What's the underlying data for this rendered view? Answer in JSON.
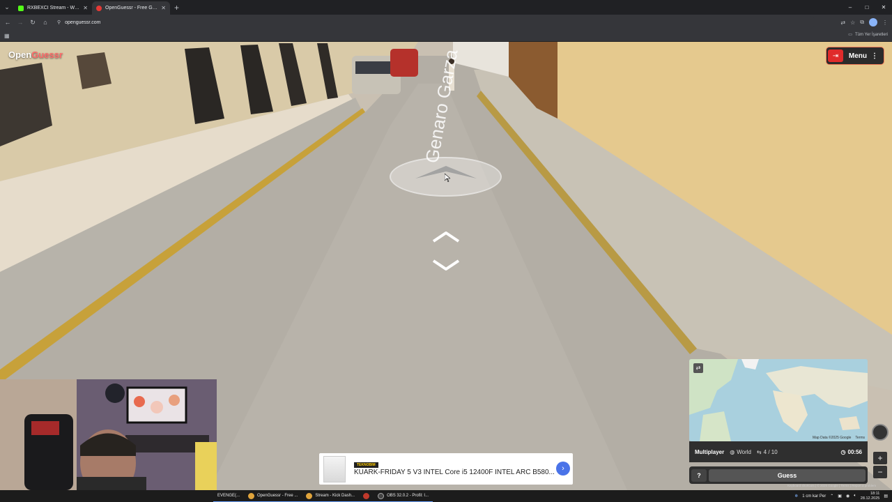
{
  "browser": {
    "tabs": [
      {
        "title": "RXBEXCI Stream - Watch Live o",
        "favicon_color": "#53fc18",
        "active": false
      },
      {
        "title": "OpenGuessr - Free GeoGuessr",
        "favicon_color": "#e53935",
        "active": true
      }
    ],
    "new_tab": "+",
    "url": "openguessr.com",
    "bookmarks_all": "Tüm Yer İşaretleri",
    "window_controls": {
      "minimize": "–",
      "maximize": "□",
      "close": "✕"
    }
  },
  "game": {
    "logo": {
      "text_main": "Open",
      "text_accent": "Guessr"
    },
    "menu_label": "Menu",
    "exit_icon": "exit-icon",
    "mode": "Multiplayer",
    "region": "World",
    "round": "4 / 10",
    "timer": "00:56",
    "guess_label": "Guess",
    "help_label": "?",
    "street_label": "Genaro Garza",
    "map_attribution": "Map Data ©2025 Google",
    "map_terms": "Terms",
    "map_footer": "Keyboard shortcuts | © 2025 Google | Terms | Report a problem",
    "zoom_in": "+",
    "zoom_out": "−"
  },
  "ad": {
    "badge": "TEKNOBIM",
    "text": "KUARK-FRIDAY 5 V3 INTEL Core i5 12400F INTEL ARC B580...",
    "cta": "›"
  },
  "taskbar": {
    "items": [
      {
        "label": "EVENGE(...",
        "color": "#555"
      },
      {
        "label": "OpenGuessr - Free ...",
        "color": "#e0a43c"
      },
      {
        "label": "Stream - Kick Dash...",
        "color": "#e0a43c"
      },
      {
        "label": "",
        "color": "#c0392b"
      },
      {
        "label": "OBS 32.0.2 - Profil: I...",
        "color": "#444"
      }
    ],
    "weather": "1 cm kar Per",
    "time": "18:11",
    "date": "28.12.2025"
  },
  "colors": {
    "accent_red": "#e02b2b",
    "panel_dark": "#2f2f2f",
    "chrome_dark": "#202124",
    "chrome_toolbar": "#35363a"
  }
}
